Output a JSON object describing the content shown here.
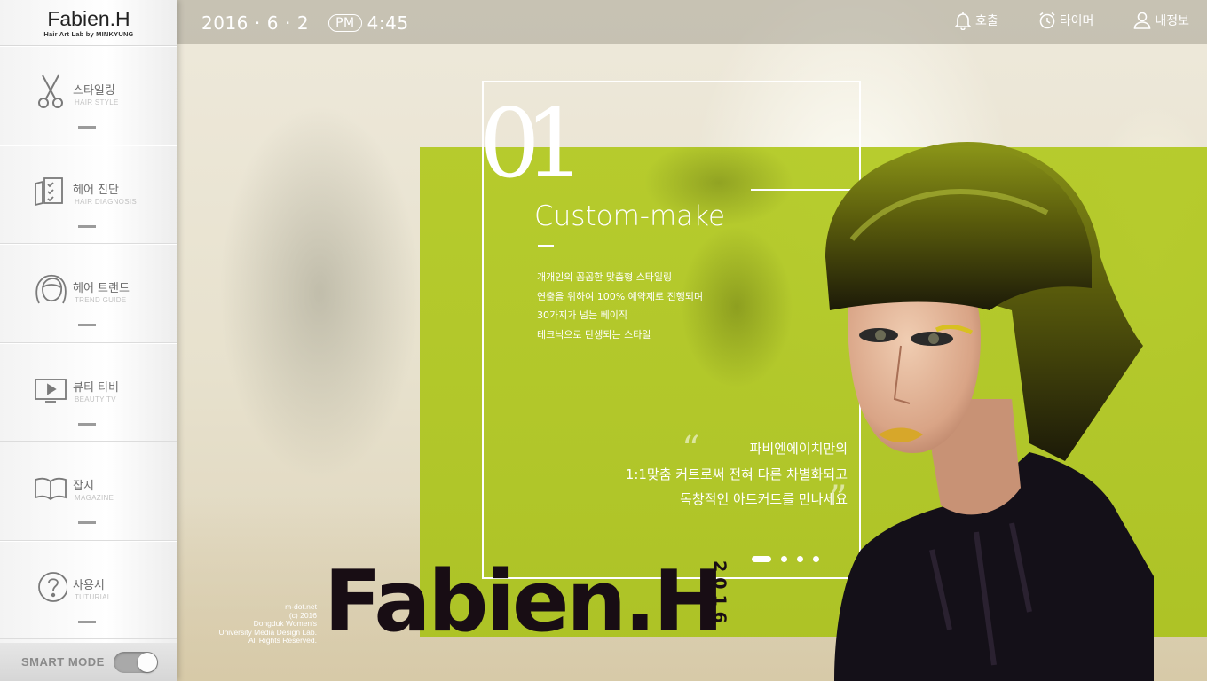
{
  "logo": {
    "name": "Fabien.H",
    "sub": "Hair Art Lab by MINKYUNG"
  },
  "topbar": {
    "year": "2016",
    "month": "6",
    "day": "2",
    "dot": "·",
    "ampm": "PM",
    "time": "4:45",
    "actions": [
      {
        "label": "호출",
        "icon": "bell-icon"
      },
      {
        "label": "타이머",
        "icon": "alarm-clock-icon"
      },
      {
        "label": "내정보",
        "icon": "user-icon"
      }
    ]
  },
  "sidebar": {
    "items": [
      {
        "label": "스타일링",
        "en": "HAIR STYLE",
        "icon": "scissors-icon"
      },
      {
        "label": "헤어 진단",
        "en": "HAIR DIAGNOSIS",
        "icon": "checklist-icon"
      },
      {
        "label": "헤어 트랜드",
        "en": "TREND GUIDE",
        "icon": "hair-head-icon"
      },
      {
        "label": "뷰티 티비",
        "en": "BEAUTY TV",
        "icon": "tv-play-icon"
      },
      {
        "label": "잡지",
        "en": "MAGAZINE",
        "icon": "open-book-icon"
      },
      {
        "label": "사용서",
        "en": "TUTURIAL",
        "icon": "question-icon"
      }
    ],
    "smart_mode": {
      "label": "SMART MODE",
      "on": true
    }
  },
  "hero": {
    "number": "01",
    "headline": "Custom-make",
    "description": [
      "개개인의 꼼꼼한 맞춤형 스타일링",
      "연출을 위하여 100% 예약제로 진행되며",
      "30가지가 넘는 베이직",
      "테크닉으로 탄생되는 스타일"
    ],
    "quote": [
      "파비엔에이치만의",
      "1:1맞춤 커트로써 전혀 다른 차별화되고",
      "독창적인 아트커트를 만나세요"
    ],
    "quote_open": "“",
    "quote_close": "”",
    "slides": {
      "count": 4,
      "active": 1
    }
  },
  "brand": {
    "title": "Fabien.H",
    "year": "2016",
    "credit": [
      "m-dot.net",
      "(c) 2016",
      "Dongduk Women's",
      "University Media Design Lab.",
      "All Rights Reserved."
    ]
  },
  "colors": {
    "accent": "#b2c920",
    "dark": "#180d14",
    "topbar": "#9a9684"
  }
}
